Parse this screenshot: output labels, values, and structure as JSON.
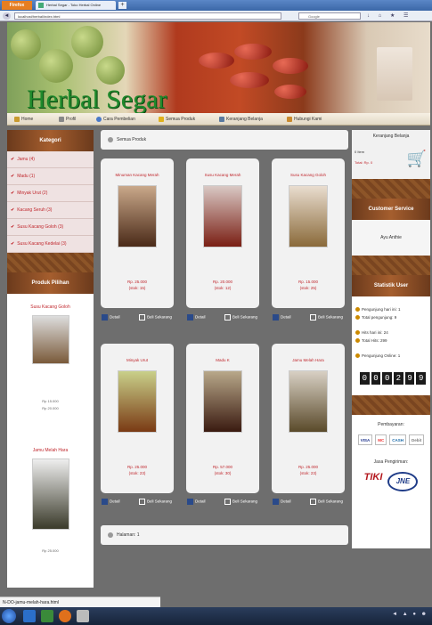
{
  "browser": {
    "menu_button": "Firefox",
    "tab_title": "Herbal Segar - Toko Herbal Online",
    "new_tab": "+",
    "url": "localhost/herbal/index.html",
    "search_placeholder": "Google",
    "nav_icons": "↓ ⌂ ★ ☰"
  },
  "header": {
    "site_title": "Herbal Segar"
  },
  "menu": [
    {
      "label": "Home",
      "color": "#c99a2e"
    },
    {
      "label": "Profil",
      "color": "#888888"
    },
    {
      "label": "Cara Pembelian",
      "color": "#4a79c8"
    },
    {
      "label": "Semua Produk",
      "color": "#e0b21c"
    },
    {
      "label": "Keranjang Belanja",
      "color": "#5a7aa0"
    },
    {
      "label": "Hubungi Kami",
      "color": "#c98a2e"
    }
  ],
  "sidebar": {
    "kategori_title": "Kategori",
    "categories": [
      "Jamu (4)",
      "Madu (1)",
      "Minyak Urut (2)",
      "Kacang Seruh (3)",
      "Susu Kacang Goloh (3)",
      "Susu Kacang Kedelai (3)"
    ],
    "featured_title": "Produk Pilihan",
    "featured": [
      {
        "name": "Susu Kacang Goloh",
        "price1": "Rp 15.000",
        "price2": "Rp 20.000"
      },
      {
        "name": "Jamu Melah Hara",
        "price1": "Rp 25.000"
      }
    ]
  },
  "main": {
    "breadcrumb": "Semua Produk",
    "products": [
      {
        "title": "Minuman Kacang Merah",
        "price": "Rp. 25.000",
        "stock": "(stok: 15)",
        "img_top": "#c9a88a",
        "img_bot": "#4a2a18"
      },
      {
        "title": "Susu Kacang Merah",
        "price": "Rp. 20.000",
        "stock": "(stok: 12)",
        "img_top": "#d9c8c4",
        "img_bot": "#7a1f14"
      },
      {
        "title": "Susu Kacang Goloh",
        "price": "Rp. 15.000",
        "stock": "(stok: 25)",
        "img_top": "#e9ddcf",
        "img_bot": "#8a6a3a"
      },
      {
        "title": "Minyak Urut",
        "price": "Rp. 25.000",
        "stock": "(stok: 23)",
        "img_top": "#c9d08a",
        "img_bot": "#7a3a14"
      },
      {
        "title": "Madu K",
        "price": "Rp. 57.000",
        "stock": "(stok: 30)",
        "img_top": "#b8a88a",
        "img_bot": "#3a1a10"
      },
      {
        "title": "Jamu Melah Hara",
        "price": "Rp. 25.000",
        "stock": "(stok: 23)",
        "img_top": "#d8d0c4",
        "img_bot": "#5a4a2a"
      }
    ],
    "detail_label": "Detail",
    "cart_label": "Beli Sekarang",
    "pagination": "Halaman: 1"
  },
  "right": {
    "cart_title": "Keranjang Belanja",
    "cart_items": "0 Item",
    "cart_total": "Total: Rp. 0",
    "cs_title": "Customer Service",
    "cs_body": "Ayu Anthie",
    "stats_title": "Statistik User",
    "stats": [
      "Pengunjung hari ini: 1",
      "Total pengunjung: 9",
      "Hits hari ini: 24",
      "Total Hits: 299",
      "Pengunjung Online: 1"
    ],
    "counter_digits": [
      "0",
      "0",
      "0",
      "2",
      "9",
      "9"
    ],
    "payment_title": "Pembayaran:",
    "payment_logos": [
      "VISA",
      "MC",
      "CASH",
      "Debit"
    ],
    "shipping_title": "Jasa Pengiriman:",
    "shipping_logos": [
      "TIKI",
      "JNE"
    ]
  },
  "statusbar": {
    "text": "N-DO-jamu-melah-hara.html"
  },
  "taskbar": {
    "tray": "◄ ▲ ● ☻"
  }
}
